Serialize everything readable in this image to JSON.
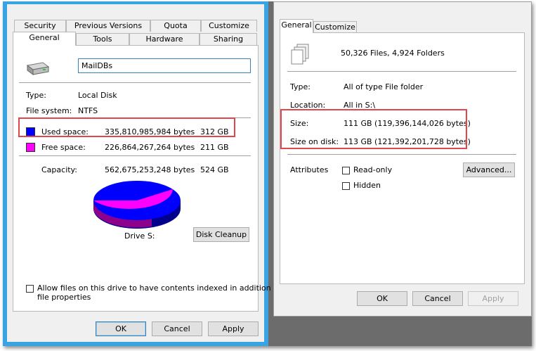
{
  "left": {
    "tabs_row1": [
      "Security",
      "Previous Versions",
      "Quota",
      "Customize"
    ],
    "tabs_row2": [
      "General",
      "Tools",
      "Hardware",
      "Sharing"
    ],
    "drive_name": "MailDBs",
    "type_label": "Type:",
    "type_value": "Local Disk",
    "fs_label": "File system:",
    "fs_value": "NTFS",
    "used_label": "Used space:",
    "used_bytes": "335,810,985,984 bytes",
    "used_gb": "312 GB",
    "free_label": "Free space:",
    "free_bytes": "226,864,267,264 bytes",
    "free_gb": "211 GB",
    "capacity_label": "Capacity:",
    "capacity_bytes": "562,675,253,248 bytes",
    "capacity_gb": "524 GB",
    "drive_caption": "Drive S:",
    "disk_cleanup": "Disk Cleanup",
    "index_text_line1": "Allow files on this drive to have contents indexed in addition to",
    "index_text_line2": "file properties",
    "ok": "OK",
    "cancel": "Cancel",
    "apply": "Apply",
    "used_fraction": 0.597,
    "colors": {
      "used": "#0000ff",
      "free": "#ff00ff"
    }
  },
  "right": {
    "tabs": [
      "General",
      "Customize"
    ],
    "summary": "50,326 Files, 4,924 Folders",
    "type_label": "Type:",
    "type_value": "All of type File folder",
    "location_label": "Location:",
    "location_value": "All in S:\\",
    "size_label": "Size:",
    "size_value": "111 GB (119,396,144,026 bytes)",
    "size_on_disk_label": "Size on disk:",
    "size_on_disk_value": "113 GB (121,392,201,728 bytes)",
    "attributes_label": "Attributes",
    "readonly_label": "Read-only",
    "hidden_label": "Hidden",
    "advanced": "Advanced...",
    "ok": "OK",
    "cancel": "Cancel",
    "apply": "Apply"
  }
}
